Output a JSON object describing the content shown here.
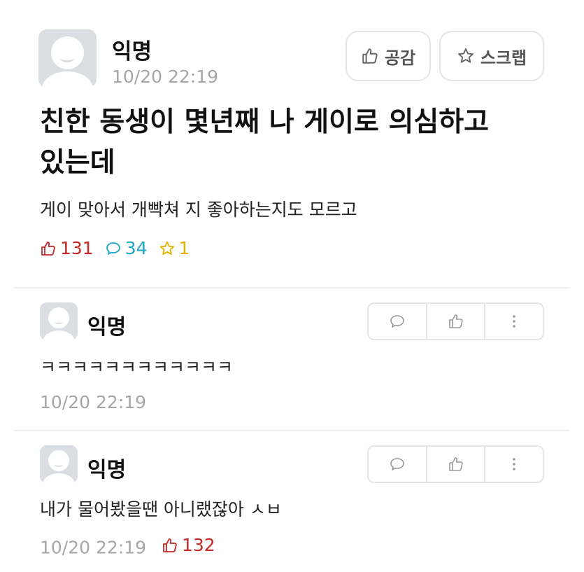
{
  "post": {
    "author": "익명",
    "timestamp": "10/20 22:19",
    "title_line1": "친한 동생이 몇년째 나 게이로 의심하고",
    "title_line2": "있는데",
    "body": "게이 맞아서 개빡쳐 지 좋아하는지도 모르고",
    "buttons": {
      "like_label": "공감",
      "scrap_label": "스크랩"
    },
    "stats": {
      "likes": "131",
      "comments": "34",
      "scraps": "1"
    }
  },
  "comments": [
    {
      "author": "익명",
      "text": "ㅋㅋㅋㅋㅋㅋㅋㅋㅋㅋㅋㅋ",
      "timestamp": "10/20 22:19",
      "likes": ""
    },
    {
      "author": "익명",
      "text": "내가 물어봤을땐 아니랬잖아 ㅅㅂ",
      "timestamp": "10/20 22:19",
      "likes": "132"
    }
  ],
  "icons": {
    "avatar": "anonymous-avatar-icon",
    "like": "thumbs-up-icon",
    "comment": "speech-bubble-icon",
    "scrap": "star-icon",
    "more": "vertical-dots-icon"
  },
  "colors": {
    "like": "#c62828",
    "comment": "#1ba6c7",
    "scrap": "#e2b100",
    "meta": "#a6a6a6",
    "avatar_bg": "#dadde1"
  }
}
